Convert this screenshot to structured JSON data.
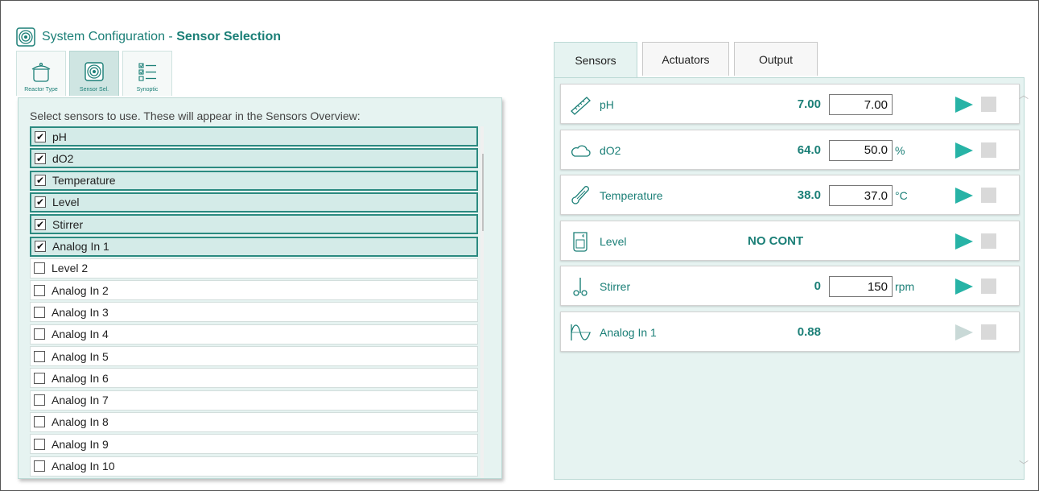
{
  "header": {
    "title_prefix": "System Configuration - ",
    "title_bold": "Sensor Selection",
    "icon": "sensor-rings-icon"
  },
  "tool_tabs": [
    {
      "label": "Reactor Type",
      "icon": "reactor-pot-icon",
      "active": false
    },
    {
      "label": "Sensor Sel.",
      "icon": "sensor-rings-icon",
      "active": true
    },
    {
      "label": "Synoptic",
      "icon": "checklist-icon",
      "active": false
    }
  ],
  "sensor_selection": {
    "instruction": "Select sensors to use. These will appear in the Sensors Overview:",
    "items": [
      {
        "label": "pH",
        "checked": true
      },
      {
        "label": "dO2",
        "checked": true
      },
      {
        "label": "Temperature",
        "checked": true
      },
      {
        "label": "Level",
        "checked": true
      },
      {
        "label": "Stirrer",
        "checked": true
      },
      {
        "label": "Analog In 1",
        "checked": true
      },
      {
        "label": "Level 2",
        "checked": false
      },
      {
        "label": "Analog In 2",
        "checked": false
      },
      {
        "label": "Analog In 3",
        "checked": false
      },
      {
        "label": "Analog In 4",
        "checked": false
      },
      {
        "label": "Analog In 5",
        "checked": false
      },
      {
        "label": "Analog In 6",
        "checked": false
      },
      {
        "label": "Analog In 7",
        "checked": false
      },
      {
        "label": "Analog In 8",
        "checked": false
      },
      {
        "label": "Analog In 9",
        "checked": false
      },
      {
        "label": "Analog In 10",
        "checked": false
      }
    ]
  },
  "right_tabs": [
    {
      "label": "Sensors",
      "active": true
    },
    {
      "label": "Actuators",
      "active": false
    },
    {
      "label": "Output",
      "active": false
    }
  ],
  "sensors": [
    {
      "name": "pH",
      "icon": "ruler-icon",
      "value": "7.00",
      "setpoint": "7.00",
      "unit": "",
      "play_active": true
    },
    {
      "name": "dO2",
      "icon": "cloud-icon",
      "value": "64.0",
      "setpoint": "50.0",
      "unit": "%",
      "play_active": true
    },
    {
      "name": "Temperature",
      "icon": "thermometer-icon",
      "value": "38.0",
      "setpoint": "37.0",
      "unit": "°C",
      "play_active": true
    },
    {
      "name": "Level",
      "icon": "beaker-icon",
      "value": "NO CONT",
      "setpoint": null,
      "unit": "",
      "play_active": true
    },
    {
      "name": "Stirrer",
      "icon": "stirrer-icon",
      "value": "0",
      "setpoint": "150",
      "unit": "rpm",
      "play_active": true
    },
    {
      "name": "Analog In 1",
      "icon": "sine-wave-icon",
      "value": "0.88",
      "setpoint": null,
      "unit": "",
      "play_active": false
    }
  ],
  "colors": {
    "accent": "#1b7f77",
    "play": "#27b3a6",
    "panel_bg": "#e6f3f1"
  }
}
